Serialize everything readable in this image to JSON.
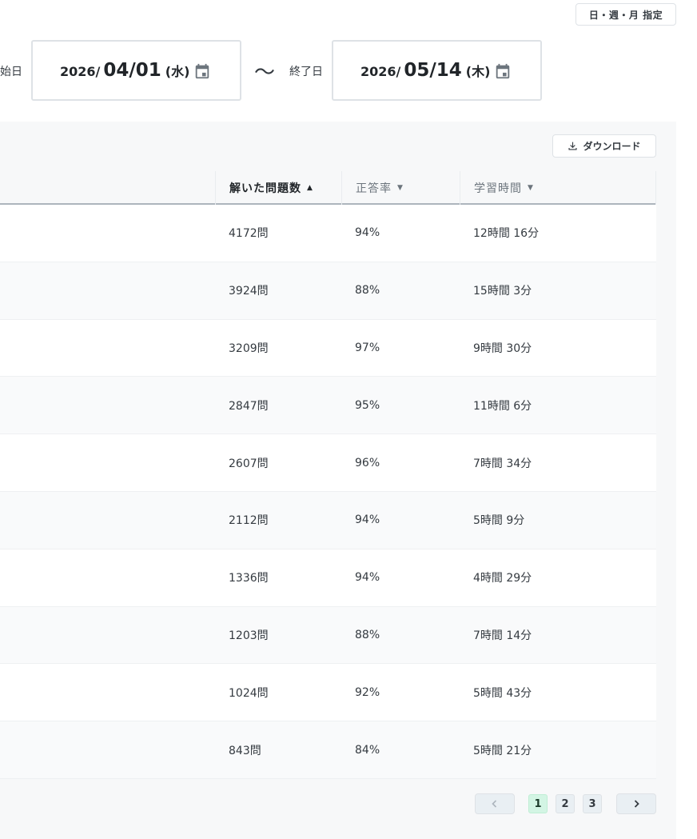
{
  "header": {
    "period_button": "日・週・月 指定",
    "start_label": "始日",
    "end_label": "終了日",
    "start_date": {
      "year": "2026/",
      "md": "04/01",
      "dow": "(水)"
    },
    "end_date": {
      "year": "2026/",
      "md": "05/14",
      "dow": "(木)"
    },
    "separator": "〜"
  },
  "toolbar": {
    "download_label": "ダウンロード"
  },
  "table": {
    "columns": [
      {
        "label": "解いた問題数",
        "sort": "asc",
        "active": true
      },
      {
        "label": "正答率",
        "sort": "desc",
        "active": false
      },
      {
        "label": "学習時間",
        "sort": "desc",
        "active": false
      }
    ],
    "rows": [
      {
        "solved": "4172問",
        "rate": "94%",
        "time": "12時間 16分"
      },
      {
        "solved": "3924問",
        "rate": "88%",
        "time": "15時間 3分"
      },
      {
        "solved": "3209問",
        "rate": "97%",
        "time": "9時間 30分"
      },
      {
        "solved": "2847問",
        "rate": "95%",
        "time": "11時間 6分"
      },
      {
        "solved": "2607問",
        "rate": "96%",
        "time": "7時間 34分"
      },
      {
        "solved": "2112問",
        "rate": "94%",
        "time": "5時間 9分"
      },
      {
        "solved": "1336問",
        "rate": "94%",
        "time": "4時間 29分"
      },
      {
        "solved": "1203問",
        "rate": "88%",
        "time": "7時間 14分"
      },
      {
        "solved": "1024問",
        "rate": "92%",
        "time": "5時間 43分"
      },
      {
        "solved": "843問",
        "rate": "84%",
        "time": "5時間 21分"
      }
    ]
  },
  "pagination": {
    "pages": [
      "1",
      "2",
      "3"
    ],
    "current": "1"
  },
  "icons": {
    "calendar": "calendar-icon",
    "download": "download-icon",
    "prev": "chevron-left-icon",
    "next": "chevron-right-icon",
    "sort_up": "▲",
    "sort_down": "▼"
  },
  "colors": {
    "current_page_bg": "#d3f5e4",
    "panel_bg": "#f7f8f9"
  }
}
